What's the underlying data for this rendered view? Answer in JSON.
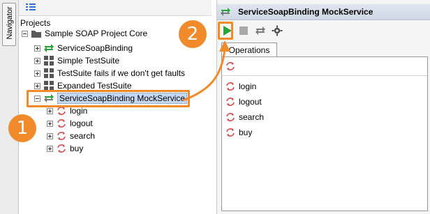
{
  "navigator_tab": "Navigator",
  "tree": {
    "root_label": "Projects",
    "project": "Sample SOAP Project Core",
    "items": [
      {
        "label": "ServiceSoapBinding",
        "icon": "interface-arrows-icon"
      },
      {
        "label": "Simple TestSuite",
        "icon": "testsuite-grid-icon"
      },
      {
        "label": "TestSuite fails if we don't get faults",
        "icon": "testsuite-grid-icon"
      },
      {
        "label": "Expanded TestSuite",
        "icon": "testsuite-grid-icon"
      },
      {
        "label": "ServiceSoapBinding MockService",
        "icon": "mockservice-arrows-icon"
      }
    ],
    "mock_operations": [
      "login",
      "logout",
      "search",
      "buy"
    ]
  },
  "mock_panel": {
    "title": "ServiceSoapBinding MockService",
    "tab_label": "Operations",
    "operations": [
      "login",
      "logout",
      "search",
      "buy"
    ]
  },
  "callouts": [
    "1",
    "2"
  ],
  "colors": {
    "accent": "#f08a2a",
    "green": "#2aa33a",
    "selection": "#c5d8f3"
  }
}
